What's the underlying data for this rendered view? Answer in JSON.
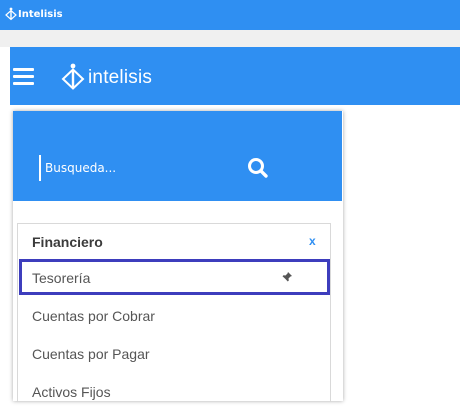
{
  "window": {
    "title": "Intelisis"
  },
  "header": {
    "logo_text": "intelisis",
    "brand_color": "#2f8ff2"
  },
  "search": {
    "placeholder": "Busqueda..."
  },
  "section": {
    "title": "Financiero",
    "close_label": "x"
  },
  "menu": {
    "items": [
      {
        "label": "Tesorería",
        "selected": true,
        "pinned": true
      },
      {
        "label": "Cuentas por Cobrar"
      },
      {
        "label": "Cuentas por Pagar"
      },
      {
        "label": "Activos Fijos"
      }
    ]
  },
  "colors": {
    "accent": "#2f8ff2",
    "selection_outline": "#3d3dbd"
  },
  "icons": [
    "app-logo-icon",
    "hamburger-menu-icon",
    "search-icon",
    "pin-icon"
  ]
}
